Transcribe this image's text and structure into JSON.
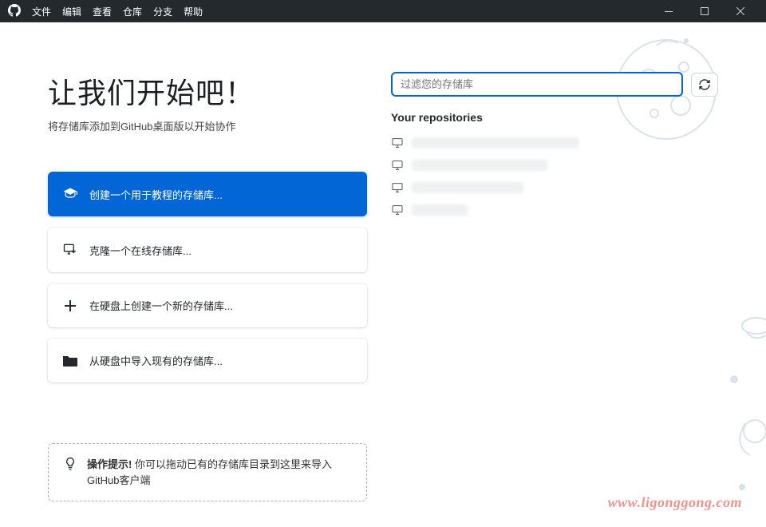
{
  "menu": {
    "file": "文件",
    "edit": "编辑",
    "view": "查看",
    "repository": "仓库",
    "branch": "分支",
    "help": "帮助"
  },
  "hero": {
    "title": "让我们开始吧！",
    "subtitle": "将存储库添加到GitHub桌面版以开始协作"
  },
  "actions": {
    "tutorial": "创建一个用于教程的存储库...",
    "clone": "克隆一个在线存储库...",
    "new_local": "在硬盘上创建一个新的存储库...",
    "import_local": "从硬盘中导入现有的存储库..."
  },
  "filter": {
    "placeholder": "过滤您的存储库"
  },
  "repos": {
    "heading": "Your repositories"
  },
  "tip": {
    "label": "操作提示!",
    "text": " 你可以拖动已有的存储库目录到这里来导入GitHub客户端"
  },
  "watermark": "www.ligonggong.com"
}
